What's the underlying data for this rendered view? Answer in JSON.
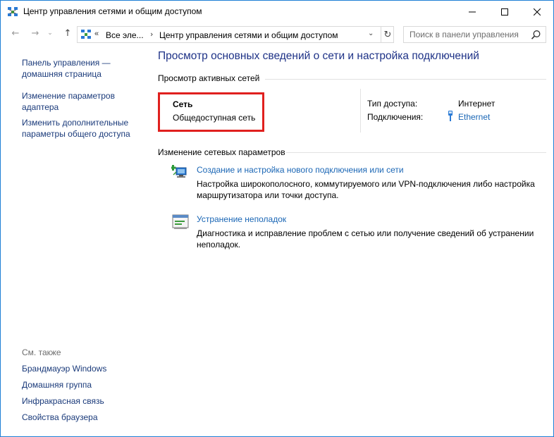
{
  "window": {
    "title": "Центр управления сетями и общим доступом",
    "minimize_glyph": "—",
    "maximize_glyph": "☐",
    "close_glyph": "✕"
  },
  "address": {
    "overflow": "«",
    "crumb_all": "Все эле...",
    "separator": "›",
    "crumb_current": "Центр управления сетями и общим доступом",
    "dropdown": "⌄",
    "refresh": "↻"
  },
  "nav": {
    "back": "←",
    "forward": "→",
    "recent": "⌄",
    "up": "↑"
  },
  "search": {
    "placeholder": "Поиск в панели управления",
    "icon": "search-icon"
  },
  "sidebar": {
    "links": [
      "Панель управления — домашняя страница",
      "Изменение параметров адаптера",
      "Изменить дополнительные параметры общего доступа"
    ],
    "see_also_label": "См. также",
    "see_also": [
      "Брандмауэр Windows",
      "Домашняя группа",
      "Инфракрасная связь",
      "Свойства браузера"
    ]
  },
  "main": {
    "title": "Просмотр основных сведений о сети и настройка подключений",
    "active_networks_heading": "Просмотр активных сетей",
    "network": {
      "name": "Сеть",
      "category": "Общедоступная сеть",
      "access_type_label": "Тип доступа:",
      "access_type_value": "Интернет",
      "connections_label": "Подключения:",
      "connection_name": "Ethernet"
    },
    "change_settings_heading": "Изменение сетевых параметров",
    "tasks": [
      {
        "icon": "new-connection-icon",
        "link": "Создание и настройка нового подключения или сети",
        "description": "Настройка широкополосного, коммутируемого или VPN-подключения либо настройка маршрутизатора или точки доступа."
      },
      {
        "icon": "troubleshoot-icon",
        "link": "Устранение неполадок",
        "description": "Диагностика и исправление проблем с сетью или получение сведений об устранении неполадок."
      }
    ]
  },
  "colors": {
    "link": "#1a66b5",
    "nav_link": "#1a3a7a",
    "title": "#1e3287",
    "highlight_box": "#e0201e",
    "window_border": "#1e7fd6"
  }
}
